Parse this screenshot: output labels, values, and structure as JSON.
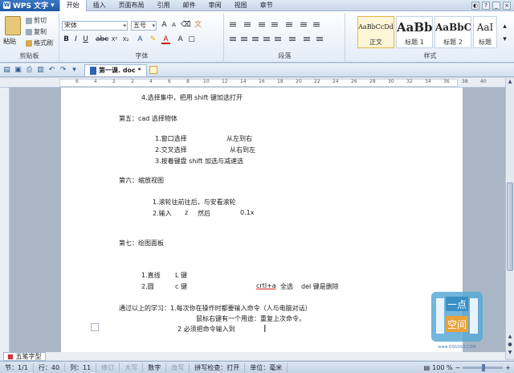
{
  "menubar": {
    "app_name": "WPS 文字",
    "tabs": [
      "开始",
      "插入",
      "页面布局",
      "引用",
      "邮件",
      "审阅",
      "视图",
      "章节"
    ],
    "active_tab": "开始"
  },
  "ribbon": {
    "clipboard": {
      "paste": "粘贴",
      "cut": "剪切",
      "copy": "复制",
      "format_painter": "格式刷",
      "label": "剪贴板"
    },
    "font": {
      "font_name": "宋体",
      "font_size": "五号",
      "label": "字体"
    },
    "paragraph": {
      "label": "段落"
    },
    "styles": {
      "label": "样式",
      "items": [
        {
          "sample": "AaBbCcDd",
          "name": "正文"
        },
        {
          "sample": "AaBb",
          "name": "标题 1"
        },
        {
          "sample": "AaBbC",
          "name": "标题 2"
        },
        {
          "sample": "AaI",
          "name": "标题"
        }
      ]
    }
  },
  "document_tab": {
    "title": "第一课. doc *"
  },
  "ruler": {
    "ticks": [
      "6",
      "4",
      "2",
      "2",
      "4",
      "6",
      "8",
      "10",
      "12",
      "14",
      "16",
      "18",
      "20",
      "22",
      "24",
      "26",
      "28",
      "30",
      "32",
      "34",
      "36",
      "38",
      "40"
    ]
  },
  "document": {
    "lines": [
      {
        "text": "4.选择集中，把用 shift 键加选打开"
      },
      {
        "text": "第五：cad 选择物体"
      },
      {
        "text": "1.窗口选择"
      },
      {
        "text": "从左到右"
      },
      {
        "text": "2.交叉选择"
      },
      {
        "text": "从右到左"
      },
      {
        "text": "3.按着键盘 shift 加选与减速选"
      },
      {
        "text": "第六：缩放视图"
      },
      {
        "text": "1.滚轮往前往后，与安看滚轮"
      },
      {
        "text": "2.输入"
      },
      {
        "text": "z"
      },
      {
        "text": "然后"
      },
      {
        "text": "0.1x"
      },
      {
        "text": "第七：绘图面板"
      },
      {
        "text": "1.直线"
      },
      {
        "text": "L 键"
      },
      {
        "text": "2.圆"
      },
      {
        "text": "c 键"
      },
      {
        "text": "crtl+a"
      },
      {
        "text": "全选"
      },
      {
        "text": "del 键是删除"
      },
      {
        "text": "通过以上的学习：1.每次你在操作时都要输入命令（人与电脑对话）"
      },
      {
        "text": "鼠标右键有一个用途：重复上次命令。"
      },
      {
        "text": "2 必须把命令输入到"
      }
    ]
  },
  "watermark": {
    "top": "一点",
    "bottom": "空间",
    "url": "www.OSGSS3.COM"
  },
  "bottom_tab": {
    "label": "五笔字型"
  },
  "status": {
    "page": "节：1/1",
    "row": "行：40",
    "col": "列：11",
    "rev": "修订",
    "caps": "大写",
    "num": "数字",
    "ovr": "改写",
    "spell": "拼写检查：打开",
    "unit": "单位：毫米",
    "zoom": "100 %"
  },
  "colors": {
    "accent": "#1f5aa5",
    "ribbon_bg": "#e3ecf7",
    "workspace": "#a9b6c6"
  }
}
